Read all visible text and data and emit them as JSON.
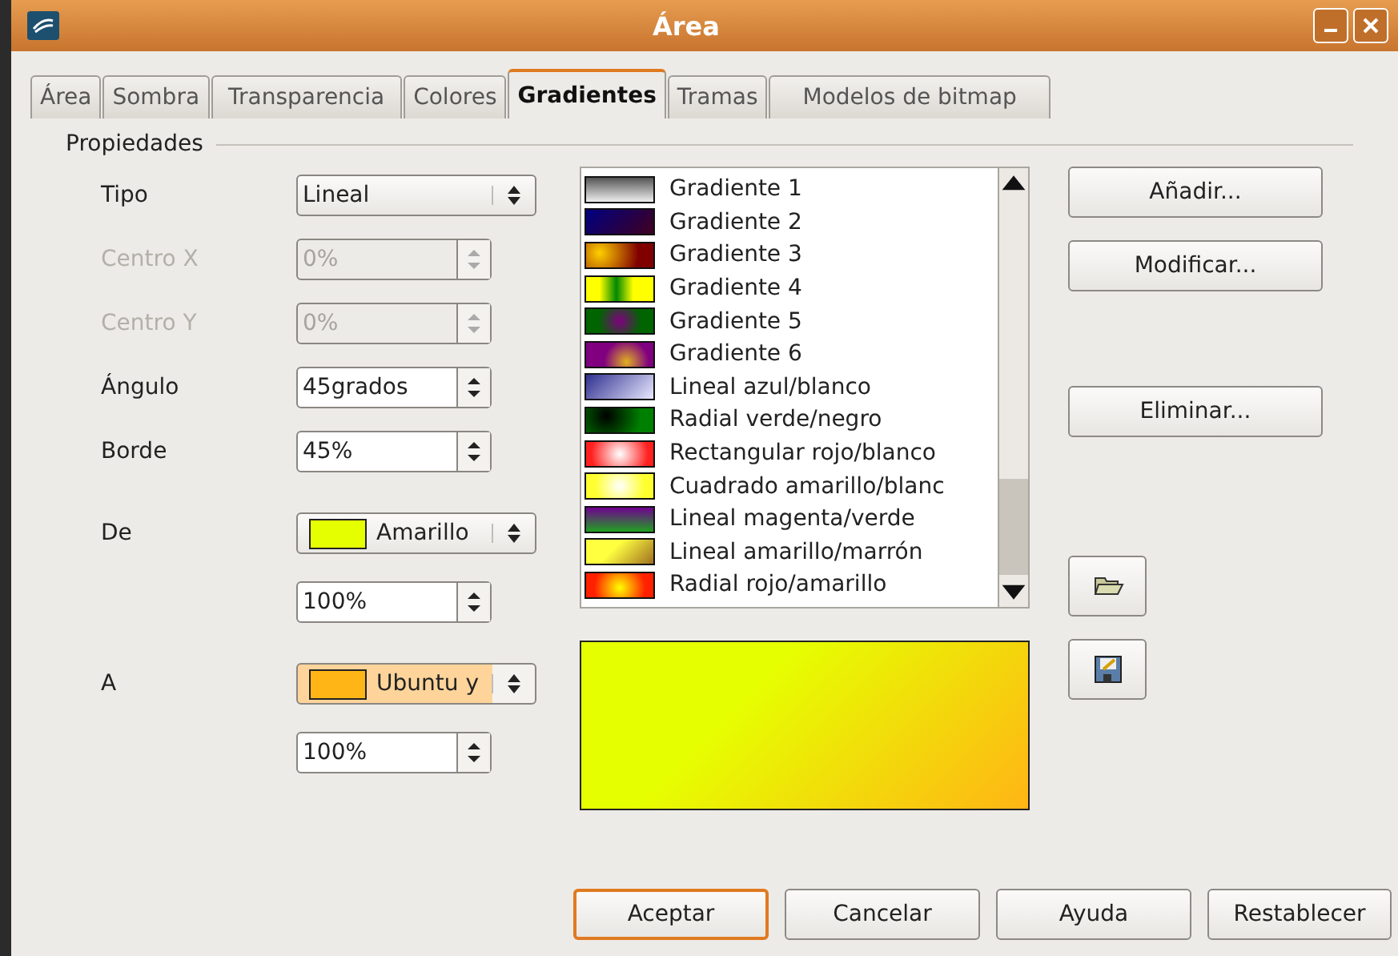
{
  "window": {
    "title": "Área"
  },
  "tabs": [
    {
      "label": "Área",
      "selected": false
    },
    {
      "label": "Sombra",
      "selected": false
    },
    {
      "label": "Transparencia",
      "selected": false
    },
    {
      "label": "Colores",
      "selected": false
    },
    {
      "label": "Gradientes",
      "selected": true
    },
    {
      "label": "Tramas",
      "selected": false
    },
    {
      "label": "Modelos de bitmap",
      "selected": false
    }
  ],
  "group": {
    "title": "Propiedades"
  },
  "fields": [
    {
      "kind": "select",
      "label": "Tipo",
      "value": "Lineal",
      "disabled": false
    },
    {
      "kind": "spin",
      "label": "Centro X",
      "value": "0%",
      "disabled": true
    },
    {
      "kind": "spin",
      "label": "Centro Y",
      "value": "0%",
      "disabled": true
    },
    {
      "kind": "spin",
      "label": "Ángulo",
      "value": "45grados",
      "disabled": false
    },
    {
      "kind": "spin",
      "label": "Borde",
      "value": "45%",
      "disabled": false
    },
    {
      "kind": "color",
      "label": "De",
      "value": "Amarillo",
      "color": "#e6ff00",
      "disabled": false,
      "focused": false
    },
    {
      "kind": "spin",
      "value": "100%",
      "disabled": false
    },
    {
      "kind": "color",
      "label": "A",
      "value": "Ubuntu y",
      "color": "#ffb515",
      "disabled": false,
      "focused": true
    },
    {
      "kind": "spin",
      "value": "100%",
      "disabled": false
    }
  ],
  "gradients": [
    {
      "name": "Gradiente 1"
    },
    {
      "name": "Gradiente 2"
    },
    {
      "name": "Gradiente 3"
    },
    {
      "name": "Gradiente 4"
    },
    {
      "name": "Gradiente 5"
    },
    {
      "name": "Gradiente 6"
    },
    {
      "name": "Lineal azul/blanco"
    },
    {
      "name": "Radial verde/negro"
    },
    {
      "name": "Rectangular rojo/blanco"
    },
    {
      "name": "Cuadrado amarillo/blanc"
    },
    {
      "name": "Lineal magenta/verde"
    },
    {
      "name": "Lineal amarillo/marrón"
    },
    {
      "name": "Radial rojo/amarillo"
    }
  ],
  "side_buttons": [
    "Añadir...",
    "Modificar...",
    "Eliminar..."
  ],
  "buttons": [
    {
      "label": "Aceptar",
      "default": true
    },
    {
      "label": "Cancelar",
      "default": false
    },
    {
      "label": "Ayuda",
      "default": false
    },
    {
      "label": "Restablecer",
      "default": false
    }
  ]
}
